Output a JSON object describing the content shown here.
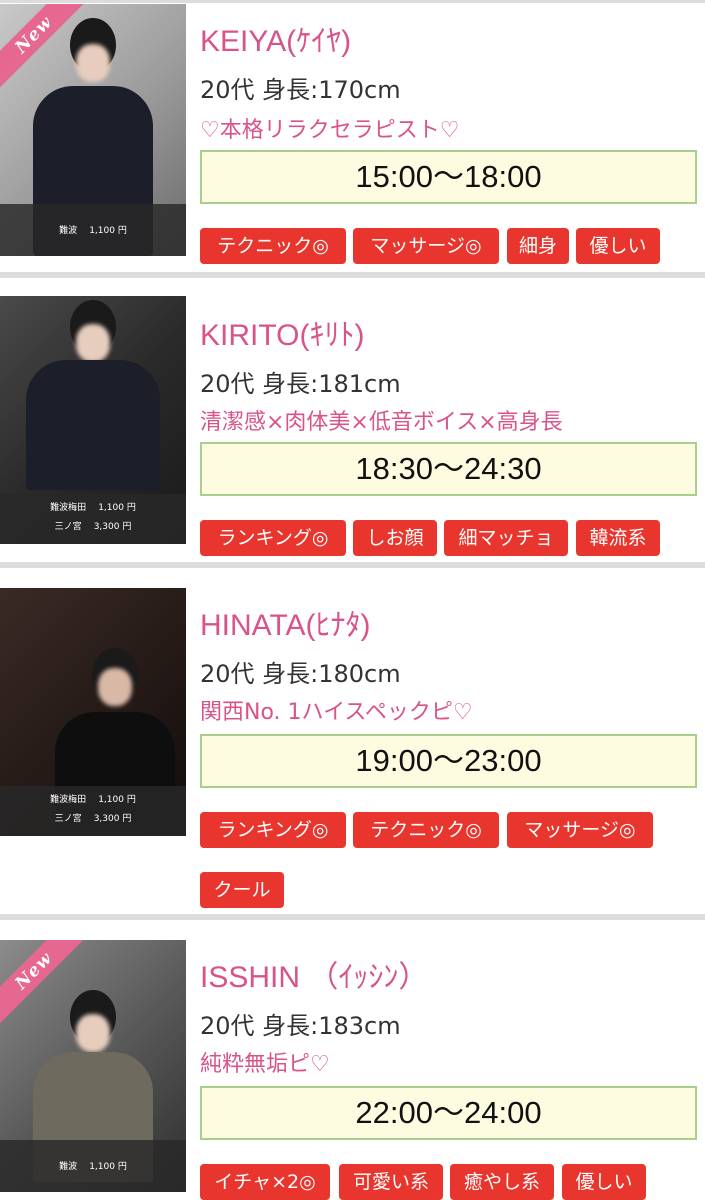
{
  "cast": [
    {
      "name": "KEIYA(ｹｲﾔ)",
      "stats": "20代 身長:170cm",
      "catch": "♡本格リラクセラピスト♡",
      "time": "15:00〜18:00",
      "is_new": true,
      "new_label": "New",
      "prices": [
        {
          "area": "難波",
          "price": "1,100 円"
        }
      ],
      "tags": [
        "テクニック◎",
        "マッサージ◎",
        "細身",
        "優しい"
      ]
    },
    {
      "name": "KIRITO(ｷﾘﾄ)",
      "stats": "20代 身長:181cm",
      "catch": "清潔感×肉体美×低音ボイス×高身長",
      "time": "18:30〜24:30",
      "is_new": false,
      "prices": [
        {
          "area": "難波梅田",
          "price": "1,100 円"
        },
        {
          "area": "三ノ宮",
          "price": "3,300 円"
        }
      ],
      "tags": [
        "ランキング◎",
        "しお顔",
        "細マッチョ",
        "韓流系"
      ]
    },
    {
      "name": "HINATA(ﾋﾅﾀ)",
      "stats": "20代 身長:180cm",
      "catch": "関西No. 1ハイスペックピ♡",
      "time": "19:00〜23:00",
      "is_new": false,
      "prices": [
        {
          "area": "難波梅田",
          "price": "1,100 円"
        },
        {
          "area": "三ノ宮",
          "price": "3,300 円"
        }
      ],
      "tags": [
        "ランキング◎",
        "テクニック◎",
        "マッサージ◎",
        "クール"
      ]
    },
    {
      "name": "ISSHIN （ｲｯｼﾝ）",
      "stats": "20代 身長:183cm",
      "catch": "純粋無垢ピ♡",
      "time": "22:00〜24:00",
      "is_new": true,
      "new_label": "New",
      "prices": [
        {
          "area": "難波",
          "price": "1,100 円"
        }
      ],
      "tags": [
        "イチャ×2◎",
        "可愛い系",
        "癒やし系",
        "優しい"
      ]
    }
  ],
  "colors": {
    "name_pink": "#d9538a",
    "tag_red": "#e8352d",
    "time_bg": "#fefce0",
    "time_border": "#a8d08a",
    "new_ribbon": "#e6678f"
  }
}
